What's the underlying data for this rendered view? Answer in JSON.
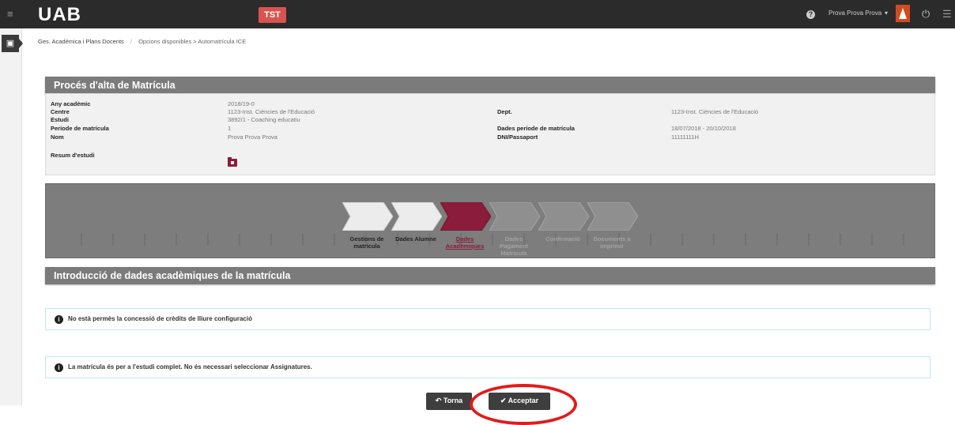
{
  "topbar": {
    "logo": "UAB",
    "env_badge": "TST",
    "help_icon": "question-circle-icon",
    "user_name": "Prova Prova Prova",
    "user_caret": "▾"
  },
  "breadcrumb": {
    "first": "Ges. Acadèmica i Plans Docents",
    "separator": "/",
    "second": "Opcions disponibles > Automatrícula ICE"
  },
  "process_panel": {
    "title": "Procés d'alta de Matrícula",
    "left": [
      {
        "label": "Any acadèmic",
        "value": "2018/19-0"
      },
      {
        "label": "Centre",
        "value": "1123-Inst. Ciències de l'Educació"
      },
      {
        "label": "Estudi",
        "value": "3892/1 - Coaching educatiu"
      },
      {
        "label": "Període de matrícula",
        "value": "1"
      },
      {
        "label": "Nom",
        "value": "Prova Prova Prova"
      },
      {
        "label": "Resum d'estudi",
        "value": ""
      }
    ],
    "right": [
      {
        "label": "Dept.",
        "value": "1123-Inst. Ciències de l'Educació"
      },
      {
        "label": "Dades període de matrícula",
        "value": "18/07/2018 - 20/10/2018"
      },
      {
        "label": "DNI/Passaport",
        "value": "11111111H"
      }
    ]
  },
  "steps": [
    {
      "line1": "Gestions de",
      "line2": "matrícula",
      "state": "done"
    },
    {
      "line1": "Dades Alumne",
      "line2": "",
      "state": "done"
    },
    {
      "line1": "Dades",
      "line2": "Acadèmiques",
      "state": "current"
    },
    {
      "line1": "Dades Pagament",
      "line2": "Matrícula",
      "state": "pending"
    },
    {
      "line1": "Confirmació",
      "line2": "",
      "state": "pending"
    },
    {
      "line1": "Documents a",
      "line2": "imprimir",
      "state": "pending"
    }
  ],
  "academic_panel": {
    "title": "Introducció de dades acadèmiques de la matrícula"
  },
  "notices": [
    {
      "text": "No està permès la concessió de crèdits de lliure configuració"
    },
    {
      "text": "La matrícula és per a l'estudi complet. No és necessari seleccionar Assignatures."
    }
  ],
  "actions": {
    "back_label": "Torna",
    "accept_label": "Acceptar"
  },
  "colors": {
    "step_done": "#ececec",
    "step_current": "#8b1c3c",
    "step_pending": "#8f8f8f",
    "highlight": "#e21b1b",
    "env_badge": "#d9534f"
  }
}
